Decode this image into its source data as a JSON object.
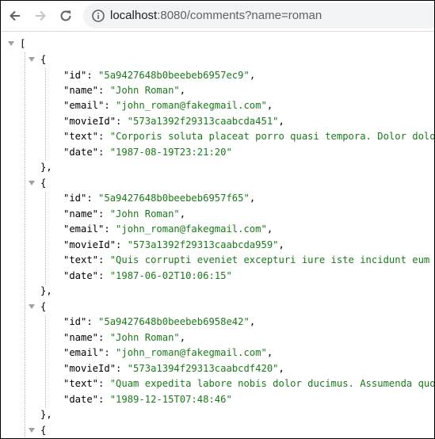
{
  "browser": {
    "url_host": "localhost",
    "url_path": ":8080/comments?name=roman"
  },
  "json_viewer": {
    "open_bracket": "[",
    "open_brace": "{",
    "close_brace_comma": "},",
    "records": [
      {
        "id_line": {
          "key": "\"id\": ",
          "value": "\"5a9427648b0beebeb6957ec9\"",
          "tail": ","
        },
        "name_line": {
          "key": "\"name\": ",
          "value": "\"John Roman\"",
          "tail": ","
        },
        "email_line": {
          "key": "\"email\": ",
          "value": "\"john_roman@fakegmail.com\"",
          "tail": ","
        },
        "movie_line": {
          "key": "\"movieId\": ",
          "value": "\"573a1392f29313caabcda451\"",
          "tail": ","
        },
        "text_line": {
          "key": "\"text\": ",
          "value": "\"Corporis soluta placeat porro quasi tempora. Dolor dolore",
          "tail": ""
        },
        "date_line": {
          "key": "\"date\": ",
          "value": "\"1987-08-19T23:21:20\"",
          "tail": ""
        }
      },
      {
        "id_line": {
          "key": "\"id\": ",
          "value": "\"5a9427648b0beebeb6957f65\"",
          "tail": ","
        },
        "name_line": {
          "key": "\"name\": ",
          "value": "\"John Roman\"",
          "tail": ","
        },
        "email_line": {
          "key": "\"email\": ",
          "value": "\"john_roman@fakegmail.com\"",
          "tail": ","
        },
        "movie_line": {
          "key": "\"movieId\": ",
          "value": "\"573a1392f29313caabcda959\"",
          "tail": ","
        },
        "text_line": {
          "key": "\"text\": ",
          "value": "\"Quis corrupti eveniet excepturi iure iste incidunt eum ni",
          "tail": ""
        },
        "date_line": {
          "key": "\"date\": ",
          "value": "\"1987-06-02T10:06:15\"",
          "tail": ""
        }
      },
      {
        "id_line": {
          "key": "\"id\": ",
          "value": "\"5a9427648b0beebeb6958e42\"",
          "tail": ","
        },
        "name_line": {
          "key": "\"name\": ",
          "value": "\"John Roman\"",
          "tail": ","
        },
        "email_line": {
          "key": "\"email\": ",
          "value": "\"john_roman@fakegmail.com\"",
          "tail": ","
        },
        "movie_line": {
          "key": "\"movieId\": ",
          "value": "\"573a1394f29313caabcdf420\"",
          "tail": ","
        },
        "text_line": {
          "key": "\"text\": ",
          "value": "\"Quam expedita labore nobis dolor ducimus. Assumenda quos",
          "tail": ""
        },
        "date_line": {
          "key": "\"date\": ",
          "value": "\"1989-12-15T07:48:46\"",
          "tail": ""
        }
      }
    ]
  }
}
